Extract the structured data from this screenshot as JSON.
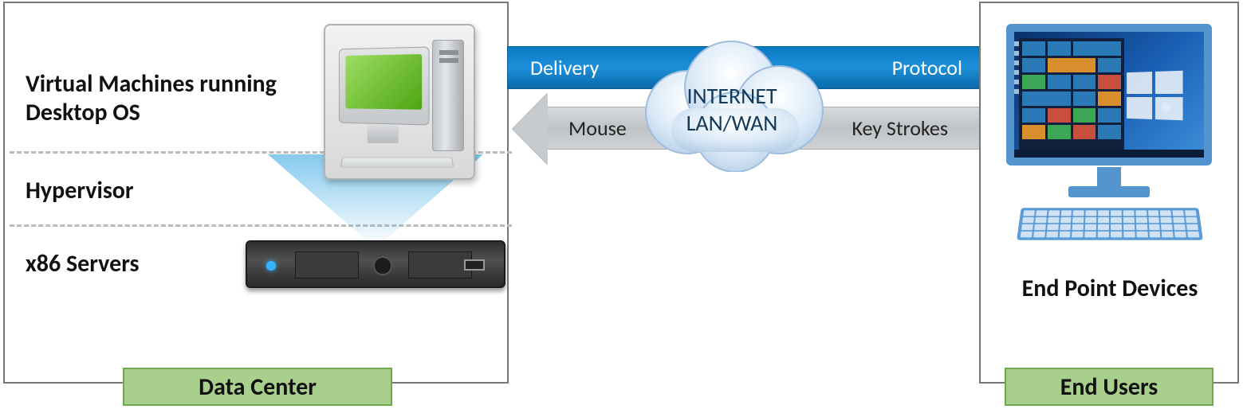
{
  "datacenter": {
    "caption": "Data Center",
    "layers": {
      "vm": "Virtual Machines running Desktop OS",
      "hyp": "Hypervisor",
      "x86": "x86 Servers"
    }
  },
  "arrows": {
    "forward": {
      "left_label": "Delivery",
      "right_label": "Protocol"
    },
    "backward": {
      "left_label": "Mouse",
      "right_label": "Key Strokes"
    }
  },
  "cloud": {
    "line1": "INTERNET",
    "line2": "LAN/WAN"
  },
  "endusers": {
    "caption": "End Users",
    "device_label": "End Point Devices"
  }
}
